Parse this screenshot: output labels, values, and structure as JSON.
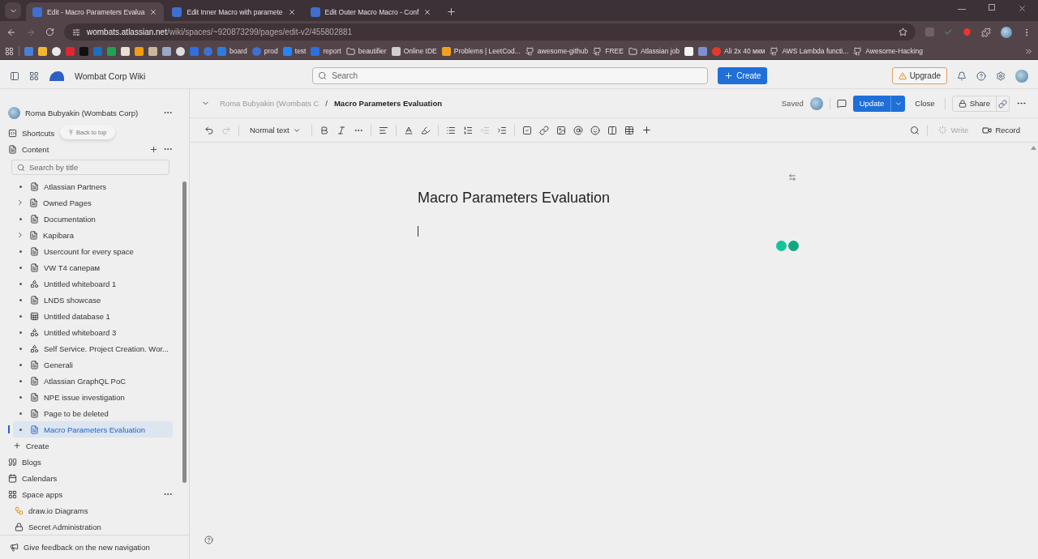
{
  "browser": {
    "tabs": [
      {
        "title": "Edit - Macro Parameters Evalua",
        "selected": true
      },
      {
        "title": "Edit Inner Macro with paramete",
        "selected": false
      },
      {
        "title": "Edit Outer Macro Macro - Conf",
        "selected": false
      }
    ],
    "url_host": "wombats.atlassian.net",
    "url_path": "/wiki/spaces/~920873299/pages/edit-v2/455802881",
    "bookmarks": [
      {
        "kind": "square",
        "color": "#4a7fd6"
      },
      {
        "kind": "square",
        "color": "#f2b632"
      },
      {
        "kind": "circle",
        "color": "#e8e8e8"
      },
      {
        "kind": "square",
        "color": "#e3262d"
      },
      {
        "kind": "square",
        "color": "#111111"
      },
      {
        "kind": "square",
        "color": "#1a6fc2"
      },
      {
        "kind": "square",
        "color": "#1fa254"
      },
      {
        "kind": "square",
        "color": "#e8e0d0"
      },
      {
        "kind": "square",
        "color": "#f39c12"
      },
      {
        "kind": "square",
        "color": "#c9b89a"
      },
      {
        "kind": "square",
        "color": "#9aa7c7"
      },
      {
        "kind": "circle",
        "color": "#dddddd"
      },
      {
        "kind": "square",
        "color": "#2f6fdf"
      },
      {
        "kind": "circle",
        "color": "#3f6fd1"
      },
      {
        "kind": "square",
        "color": "#2b7ce0",
        "label": "board"
      },
      {
        "kind": "circle",
        "color": "#3f6fd1",
        "label": "prod"
      },
      {
        "kind": "square",
        "color": "#2684ff",
        "label": "test"
      },
      {
        "kind": "square",
        "color": "#2f6fdf",
        "label": "report"
      },
      {
        "kind": "folder",
        "label": "beautifier"
      },
      {
        "kind": "square",
        "color": "#cfcfcf",
        "label": "Online IDE"
      },
      {
        "kind": "square",
        "color": "#f0a020",
        "label": "Problems | LeetCod..."
      },
      {
        "kind": "github",
        "label": "awesome-github"
      },
      {
        "kind": "github",
        "label": "FREE"
      },
      {
        "kind": "folder",
        "label": "Atlassian job"
      },
      {
        "kind": "square",
        "color": "#f4f4f4"
      },
      {
        "kind": "square",
        "color": "#7f8fd0"
      },
      {
        "kind": "circle",
        "color": "#e4392b",
        "label": "Ali 2x 40 мкм"
      },
      {
        "kind": "github",
        "label": "AWS Lambda functi..."
      },
      {
        "kind": "github",
        "label": "Awesome-Hacking"
      }
    ]
  },
  "app": {
    "name": "Wombat Corp Wiki",
    "search": {
      "placeholder": "Search"
    },
    "create": "Create",
    "upgrade": "Upgrade"
  },
  "sidebar": {
    "space": "Roma Bubyakin (Wombats Corp)",
    "back_to_top": "Back to top",
    "shortcuts": "Shortcuts",
    "content": "Content",
    "search": {
      "placeholder": "Search by title"
    },
    "pages": [
      {
        "title": "Atlassian Partners",
        "kind": "page",
        "expandable": false,
        "selected": false
      },
      {
        "title": "Owned Pages",
        "kind": "page",
        "expandable": true,
        "selected": false
      },
      {
        "title": "Documentation",
        "kind": "page",
        "expandable": false,
        "selected": false
      },
      {
        "title": "Kapibara",
        "kind": "page",
        "expandable": true,
        "selected": false
      },
      {
        "title": "Usercount for every space",
        "kind": "page",
        "expandable": false,
        "selected": false
      },
      {
        "title": "VW T4 саперам",
        "kind": "page",
        "expandable": false,
        "selected": false
      },
      {
        "title": "Untitled whiteboard 1",
        "kind": "whiteboard",
        "expandable": false,
        "selected": false
      },
      {
        "title": "LNDS showcase",
        "kind": "page",
        "expandable": false,
        "selected": false
      },
      {
        "title": "Untitled database 1",
        "kind": "database",
        "expandable": false,
        "selected": false
      },
      {
        "title": "Untitled whiteboard 3",
        "kind": "whiteboard",
        "expandable": false,
        "selected": false
      },
      {
        "title": "Self Service. Project Creation. Wor...",
        "kind": "whiteboard",
        "expandable": false,
        "selected": false
      },
      {
        "title": "Generali",
        "kind": "page",
        "expandable": false,
        "selected": false
      },
      {
        "title": "Atlassian GraphQL PoC",
        "kind": "page",
        "expandable": false,
        "selected": false
      },
      {
        "title": "NPE issue investigation",
        "kind": "page",
        "expandable": false,
        "selected": false
      },
      {
        "title": "Page to be deleted",
        "kind": "page",
        "expandable": false,
        "selected": false
      },
      {
        "title": "Macro Parameters Evaluation",
        "kind": "page",
        "expandable": false,
        "selected": true
      }
    ],
    "create": "Create",
    "links": [
      {
        "kind": "blogs",
        "label": "Blogs"
      },
      {
        "kind": "calendars",
        "label": "Calendars"
      },
      {
        "kind": "apps",
        "label": "Space apps"
      }
    ],
    "apps": [
      {
        "kind": "drawio",
        "label": "draw.io Diagrams"
      },
      {
        "kind": "secret",
        "label": "Secret Administration"
      }
    ],
    "feedback": "Give feedback on the new navigation"
  },
  "page_header": {
    "breadcrumb": "Roma Bubyakin (Wombats C",
    "separator": "/",
    "title": "Macro Parameters Evaluation",
    "status": "Saved",
    "update": "Update",
    "close": "Close",
    "share": "Share"
  },
  "toolbar": {
    "style": "Normal text",
    "write": {
      "label": "Write",
      "disabled": true
    },
    "record": "Record"
  },
  "editor": {
    "title": "Macro Parameters Evaluation"
  }
}
